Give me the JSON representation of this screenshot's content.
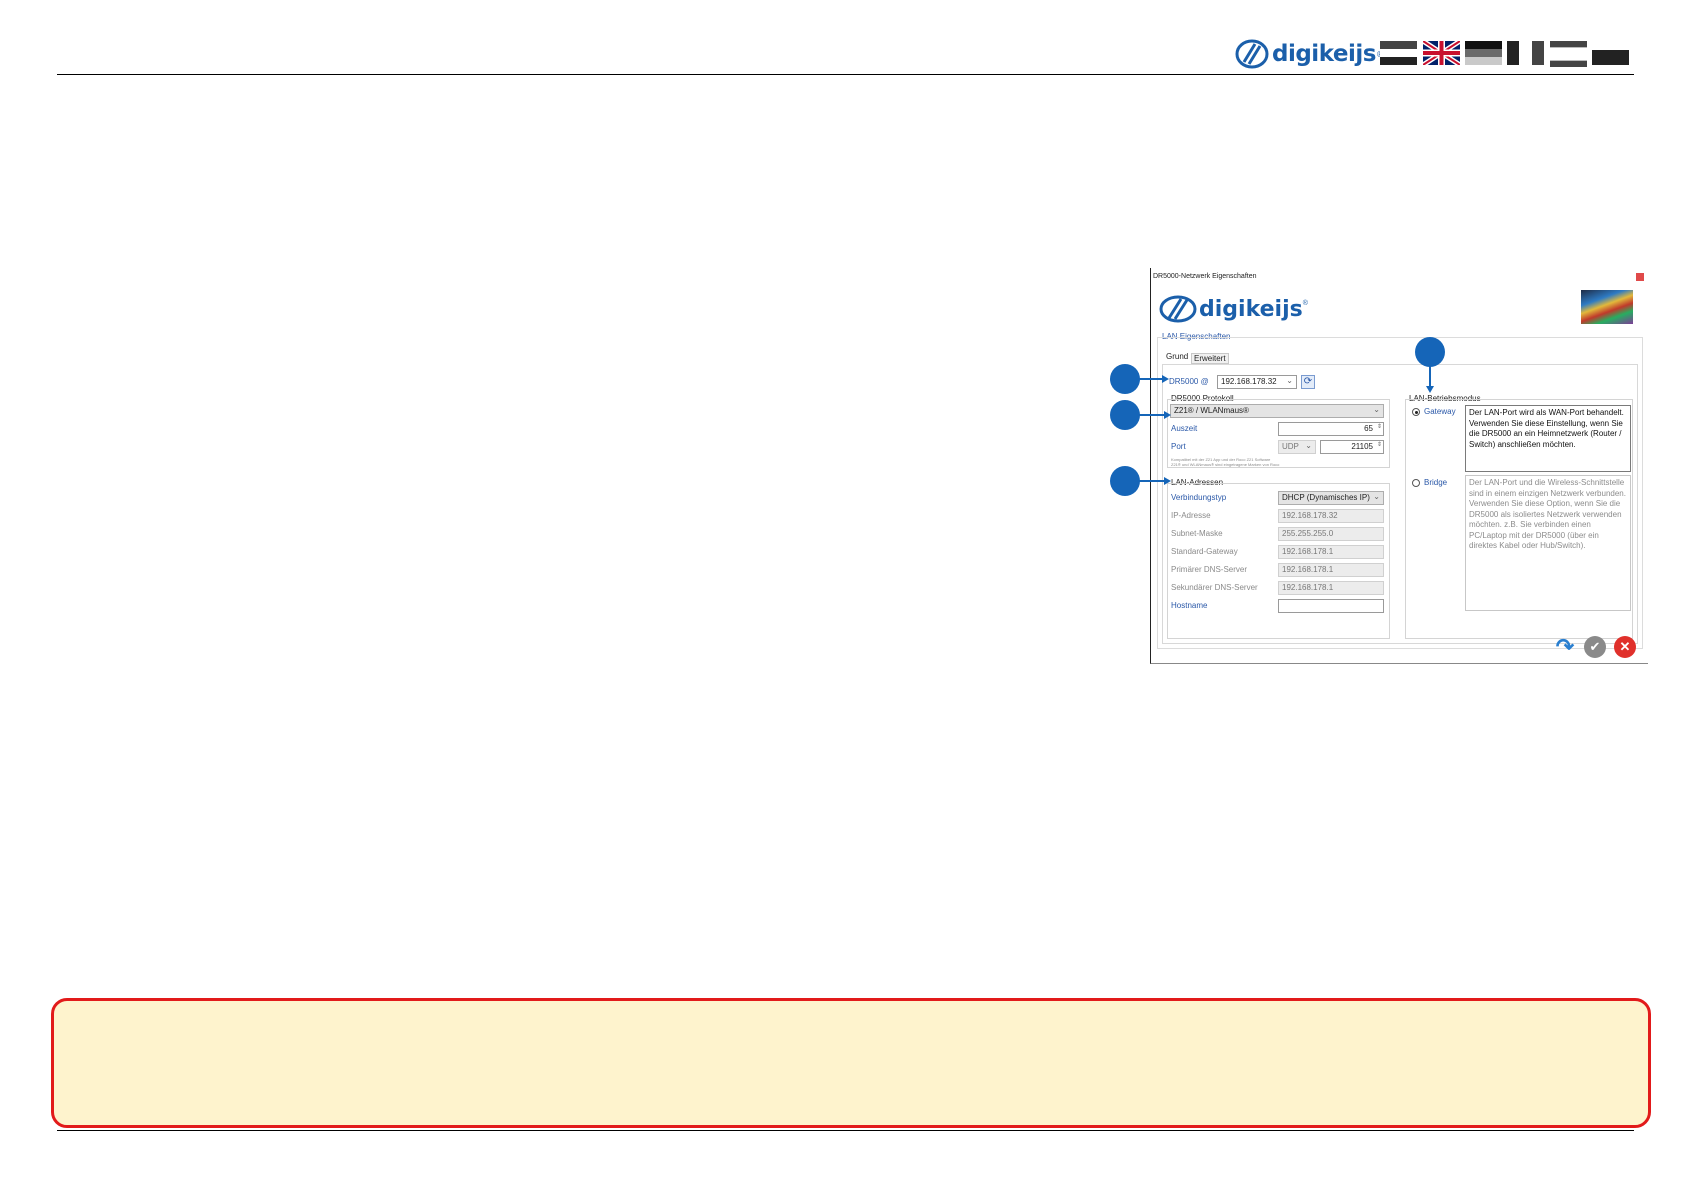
{
  "header": {
    "logo_text": "digikeijs",
    "logo_reg": "®",
    "flags": [
      "NL",
      "GB",
      "DE",
      "FR",
      "ES",
      "IT"
    ]
  },
  "dialog": {
    "title": "DR5000-Netzwerk Eigenschaften",
    "logo_text": "digikeijs",
    "logo_reg": "®",
    "group_label": "LAN Eigenschaften",
    "tabs": [
      "Grund",
      "Erweitert"
    ],
    "device_label": "DR5000 @",
    "device_ip": "192.168.178.32",
    "protocol": {
      "label": "DR5000 Protokoll",
      "value": "Z21® / WLANmaus®",
      "timeout_label": "Auszeit",
      "timeout_value": "65",
      "port_label": "Port",
      "port_type": "UDP",
      "port_value": "21105",
      "footnote_1": "Kompatibel mit der Z21 App und der Roco Z21 Software",
      "footnote_2": "Z21® und WLANmaus® sind eingetragene Marken von Roco"
    },
    "lan": {
      "label": "LAN-Adressen",
      "conn_type_label": "Verbindungstyp",
      "conn_type_value": "DHCP   (Dynamisches IP)",
      "rows": [
        {
          "label": "IP-Adresse",
          "value": "192.168.178.32"
        },
        {
          "label": "Subnet-Maske",
          "value": "255.255.255.0"
        },
        {
          "label": "Standard-Gateway",
          "value": "192.168.178.1"
        },
        {
          "label": "Primärer DNS-Server",
          "value": "192.168.178.1"
        },
        {
          "label": "Sekundärer DNS-Server",
          "value": "192.168.178.1"
        }
      ],
      "hostname_label": "Hostname",
      "hostname_value": ""
    },
    "mode": {
      "label": "LAN-Betriebsmodus",
      "gateway_label": "Gateway",
      "gateway_desc": "Der LAN-Port wird als WAN-Port behandelt. Verwenden Sie diese Einstellung, wenn Sie die DR5000 an ein Heimnetzwerk (Router / Switch) anschließen möchten.",
      "bridge_label": "Bridge",
      "bridge_desc": "Der LAN-Port und die Wireless-Schnittstelle sind in einem einzigen Netzwerk verbunden. Verwenden Sie diese Option, wenn Sie die DR5000 als isoliertes Netzwerk verwenden möchten. z.B. Sie verbinden einen PC/Laptop mit der DR5000 (über ein direktes Kabel oder Hub/Switch)."
    }
  },
  "note": {
    "text": ""
  }
}
